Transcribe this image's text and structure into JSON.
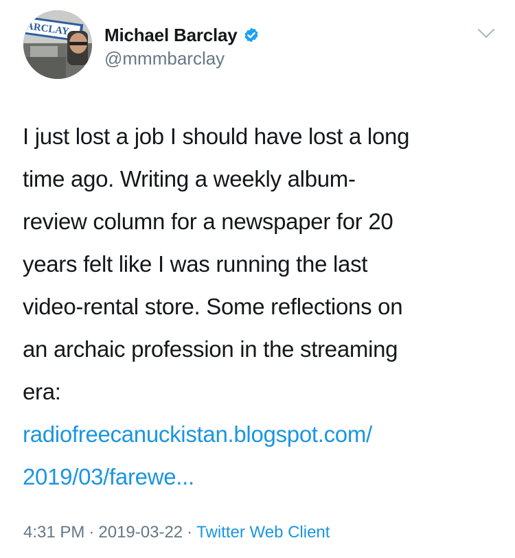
{
  "author": {
    "display_name": "Michael Barclay",
    "handle": "@mmmbarclay",
    "verified": true,
    "avatar_sign_text": "ARCLAY"
  },
  "tweet": {
    "lines": [
      "I just lost a job I should have lost a long",
      "time ago. Writing a weekly album-",
      "review column for a newspaper for 20",
      "years felt like I was running the last",
      "video-rental store. Some reflections on",
      "an archaic profession in the streaming",
      "era:"
    ],
    "link_lines": [
      "radiofreecanuckistan.blogspot.com/",
      "2019/03/farewe..."
    ]
  },
  "meta": {
    "time": "4:31 PM",
    "separator": "·",
    "date": "2019-03-22",
    "client": "Twitter Web Client"
  },
  "colors": {
    "link": "#1b95e0",
    "secondary_text": "#657786",
    "verified_badge": "#1da1f2"
  },
  "icons": {
    "verified": "verified-badge-icon",
    "menu": "chevron-down-icon"
  }
}
